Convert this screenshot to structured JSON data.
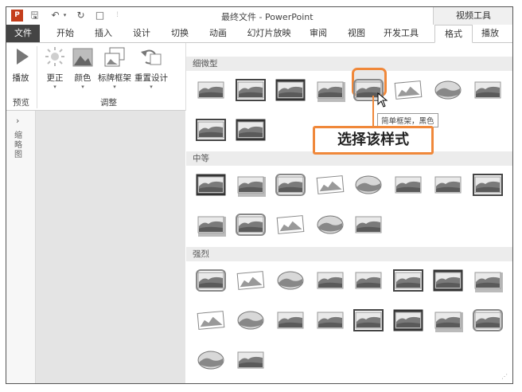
{
  "titlebar": {
    "title": "最终文件 - PowerPoint",
    "contextual_group": "视频工具"
  },
  "tabs": [
    "文件",
    "开始",
    "插入",
    "设计",
    "切换",
    "动画",
    "幻灯片放映",
    "审阅",
    "视图",
    "开发工具",
    "格式",
    "播放"
  ],
  "active_tab": "格式",
  "ribbon": {
    "play_label": "播放",
    "corrections_label": "更正",
    "color_label": "颜色",
    "poster_frame_label": "标牌框架",
    "reset_design_label": "重置设计",
    "preview_group": "预览",
    "adjust_group": "调整"
  },
  "side_pane": {
    "chevron": "›",
    "vertical_label": "缩略图"
  },
  "gallery": {
    "categories": [
      "细微型",
      "中等",
      "强烈"
    ],
    "tooltip": "简单框架，黑色",
    "callout": "选择该样式"
  },
  "colors": {
    "accent": "#f0883a",
    "file_tab": "#444444"
  }
}
